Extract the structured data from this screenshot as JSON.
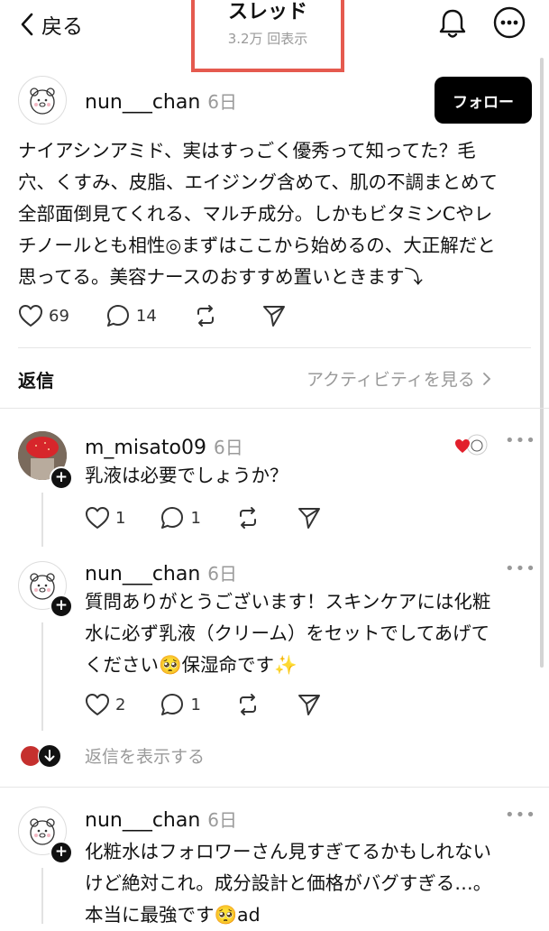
{
  "header": {
    "back_label": "戻る",
    "title": "スレッド",
    "views": "3.2万 回表示"
  },
  "main_post": {
    "username": "nun___chan",
    "time": "6日",
    "follow_label": "フォロー",
    "text_lines": [
      "ナイアシンアミド、実はすっごく優秀って知ってた？毛",
      "穴、くすみ、皮脂、エイジング含めて、肌の不調まとめて",
      "全部面倒見てくれる、マルチ成分。しかもビタミンCやレ",
      "チノールとも相性◎まずはここから始めるの、大正解だと",
      "思ってる。美容ナースのおすすめ置いときます⤵"
    ],
    "likes": "69",
    "comments": "14"
  },
  "replies_bar": {
    "label": "返信",
    "activity_link": "アクティビティを見る"
  },
  "reply1": {
    "username": "m_misato09",
    "time": "6日",
    "text": "乳液は必要でしょうか？",
    "likes": "1",
    "comments": "1"
  },
  "reply2": {
    "username": "nun___chan",
    "time": "6日",
    "text_lines": [
      "質問ありがとうございます！スキンケアには化粧",
      "水に必ず乳液（クリーム）をセットでしてあげて",
      "ください🥺保湿命です✨"
    ],
    "likes": "2",
    "comments": "1"
  },
  "show_replies": {
    "label": "返信を表示する"
  },
  "post3": {
    "username": "nun___chan",
    "time": "6日",
    "text_lines": [
      "化粧水はフォロワーさん見すぎてるかもしれない",
      "けど絶対これ。成分設計と価格がバグすぎる…。",
      "本当に最強です🥺ad"
    ]
  },
  "colors": {
    "highlight_border": "#e55a4f",
    "follow_bg": "#000000",
    "muted": "#9a9a9a"
  }
}
